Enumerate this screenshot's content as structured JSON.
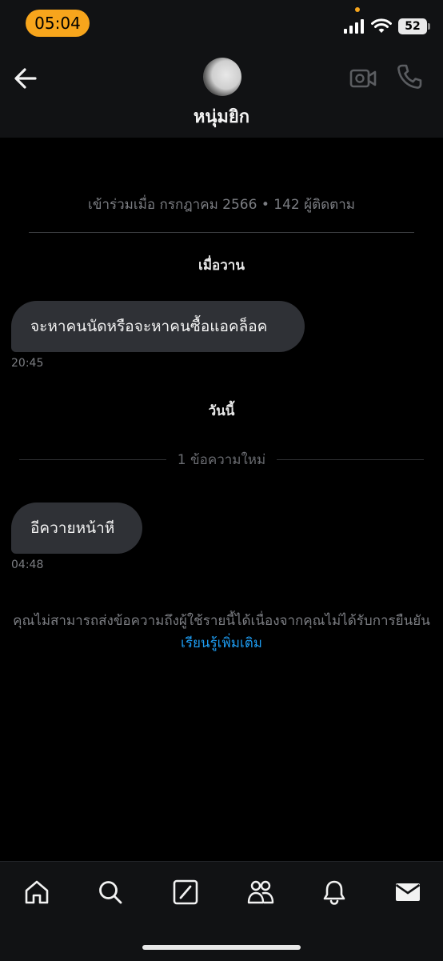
{
  "status_bar": {
    "time": "05:04",
    "battery": "52"
  },
  "header": {
    "name": "หนุ่มยิก"
  },
  "profile_info": "เข้าร่วมเมื่อ กรกฎาคม 2566 • 142 ผู้ติดตาม",
  "sections": {
    "yesterday": "เมื่อวาน",
    "today": "วันนี้",
    "new_messages": "1 ข้อความใหม่"
  },
  "messages": [
    {
      "text": "จะหาคนนัดหรือจะหาคนซื้อแอคล็อค",
      "time": "20:45"
    },
    {
      "text": "อีควายหน้าหี",
      "time": "04:48"
    }
  ],
  "notice": {
    "text": "คุณไม่สามารถส่งข้อความถึงผู้ใช้รายนี้ได้เนื่องจากคุณไม่ได้รับการยืนยัน",
    "link": "เรียนรู้เพิ่มเติม"
  },
  "icons": {
    "back": "back-arrow-icon",
    "video": "video-camera-icon",
    "call": "phone-icon",
    "nav": [
      "home-icon",
      "search-icon",
      "compose-icon",
      "communities-icon",
      "bell-icon",
      "mail-icon"
    ]
  },
  "colors": {
    "accent": "#1d9bf0",
    "time_pill": "#f7a51c",
    "bubble": "#2f3136"
  }
}
